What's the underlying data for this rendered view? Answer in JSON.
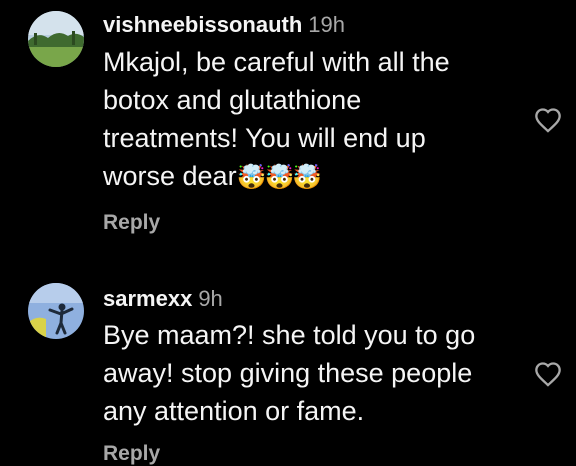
{
  "comments": [
    {
      "username": "vishneebissonauth",
      "time": "19h",
      "lines": [
        "Mkajol, be careful with all the",
        "botox and glutathione",
        "treatments! You will end up",
        "worse dear"
      ],
      "emoji": "🤯🤯🤯",
      "reply_label": "Reply",
      "avatar_icon": "landscape-photo-avatar",
      "like_icon": "heart-outline-icon"
    },
    {
      "username": "sarmexx",
      "time": "9h",
      "lines": [
        "Bye maam?! she told you to go",
        "away! stop giving these people",
        "any attention or fame."
      ],
      "reply_label": "Reply",
      "avatar_icon": "person-sky-avatar",
      "like_icon": "heart-outline-icon"
    }
  ],
  "colors": {
    "background": "#000000",
    "text": "#f5f5f5",
    "secondary": "#a8a8a8"
  }
}
